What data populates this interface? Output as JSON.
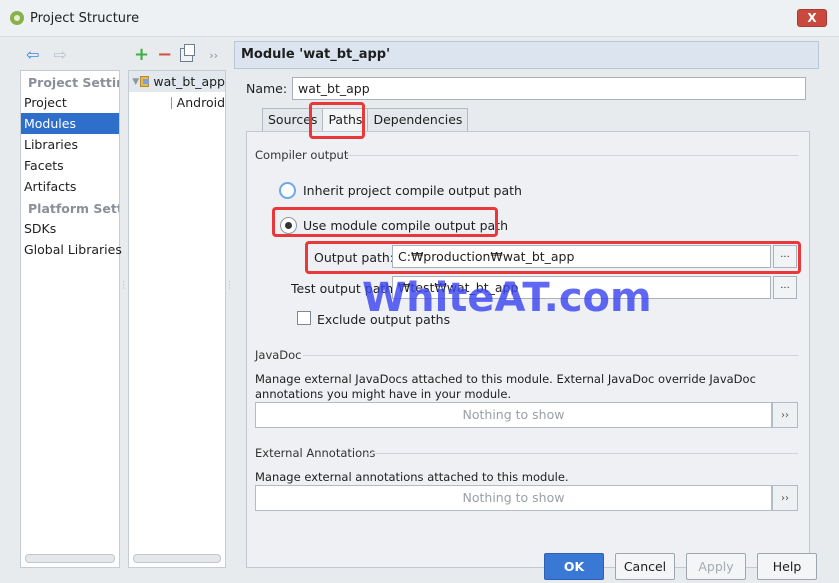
{
  "window": {
    "title": "Project Structure",
    "close_label": "X"
  },
  "left_nav": {
    "project_settings_header": "Project Settings",
    "project_items": [
      "Project",
      "Modules",
      "Libraries",
      "Facets",
      "Artifacts"
    ],
    "platform_settings_header": "Platform Settings",
    "platform_items": [
      "SDKs",
      "Global Libraries"
    ],
    "selected": "Modules"
  },
  "tree": {
    "module_name": "wat_bt_app",
    "child_name": "Android"
  },
  "module": {
    "header": "Module 'wat_bt_app'",
    "name_label": "Name:",
    "name_value": "wat_bt_app",
    "tabs": [
      "Sources",
      "Paths",
      "Dependencies"
    ],
    "active_tab": "Paths"
  },
  "paths": {
    "compiler_output_title": "Compiler output",
    "inherit_label": "Inherit project compile output path",
    "use_module_label": "Use module compile output path",
    "selected_option": "use_module",
    "output_path_label": "Output path:",
    "output_path_value": "C:₩production₩wat_bt_app",
    "test_output_label": "Test output path:",
    "test_output_value": "₩test₩wat_bt_app",
    "exclude_label": "Exclude output paths",
    "exclude_checked": false,
    "browse_label": "...",
    "javadoc_title": "JavaDoc",
    "javadoc_desc": "Manage external JavaDocs attached to this module. External JavaDoc override JavaDoc annotations you might have in your module.",
    "javadoc_empty": "Nothing to show",
    "annotations_title": "External Annotations",
    "annotations_desc": "Manage external annotations attached to this module.",
    "annotations_empty": "Nothing to show",
    "expand_label": "››"
  },
  "watermark": "WhiteAT.com",
  "buttons": {
    "ok": "OK",
    "cancel": "Cancel",
    "apply": "Apply",
    "help": "Help"
  },
  "colors": {
    "highlight": "#e8383a",
    "selection": "#2f6fcc",
    "watermark": "#3c46f0"
  }
}
